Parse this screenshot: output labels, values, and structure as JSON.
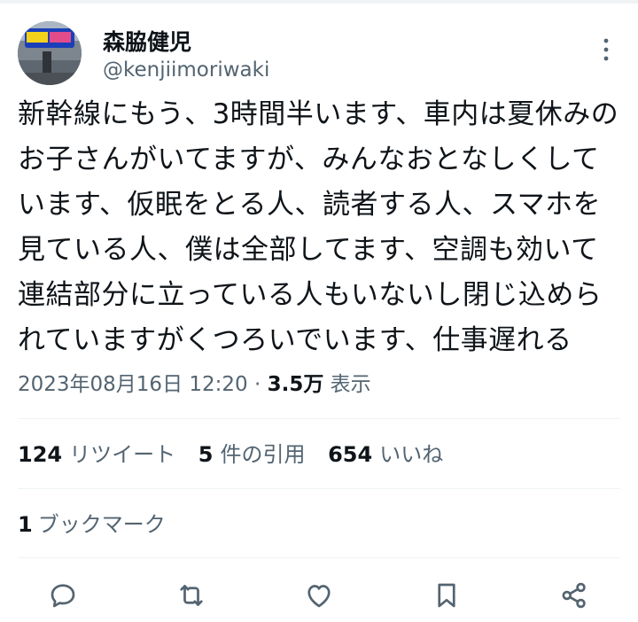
{
  "author": {
    "display_name": "森脇健児",
    "handle": "@kenjiimoriwaki",
    "avatar_icon": "profile-photo"
  },
  "tweet": {
    "text": "新幹線にもう、3時間半います、車内は夏休みのお子さんがいてますが、みんなおとなしくしています、仮眠をとる人、読者する人、スマホを見ている人、僕は全部してます、空調も効いて連結部分に立っている人もいないし閉じ込められていますがくつろいでいます、仕事遅れる",
    "timestamp": "2023年08月16日 12:20",
    "separator": "·",
    "views_count": "3.5万",
    "views_label": "表示"
  },
  "stats": {
    "retweets_count": "124",
    "retweets_label": "リツイート",
    "quotes_count": "5",
    "quotes_label": "件の引用",
    "likes_count": "654",
    "likes_label": "いいね",
    "bookmarks_count": "1",
    "bookmarks_label": "ブックマーク"
  },
  "actions": [
    "reply-icon",
    "retweet-icon",
    "like-icon",
    "bookmark-icon",
    "share-icon"
  ],
  "colors": {
    "text": "#0f1419",
    "secondary": "#536471",
    "divider": "#eff3f4"
  }
}
